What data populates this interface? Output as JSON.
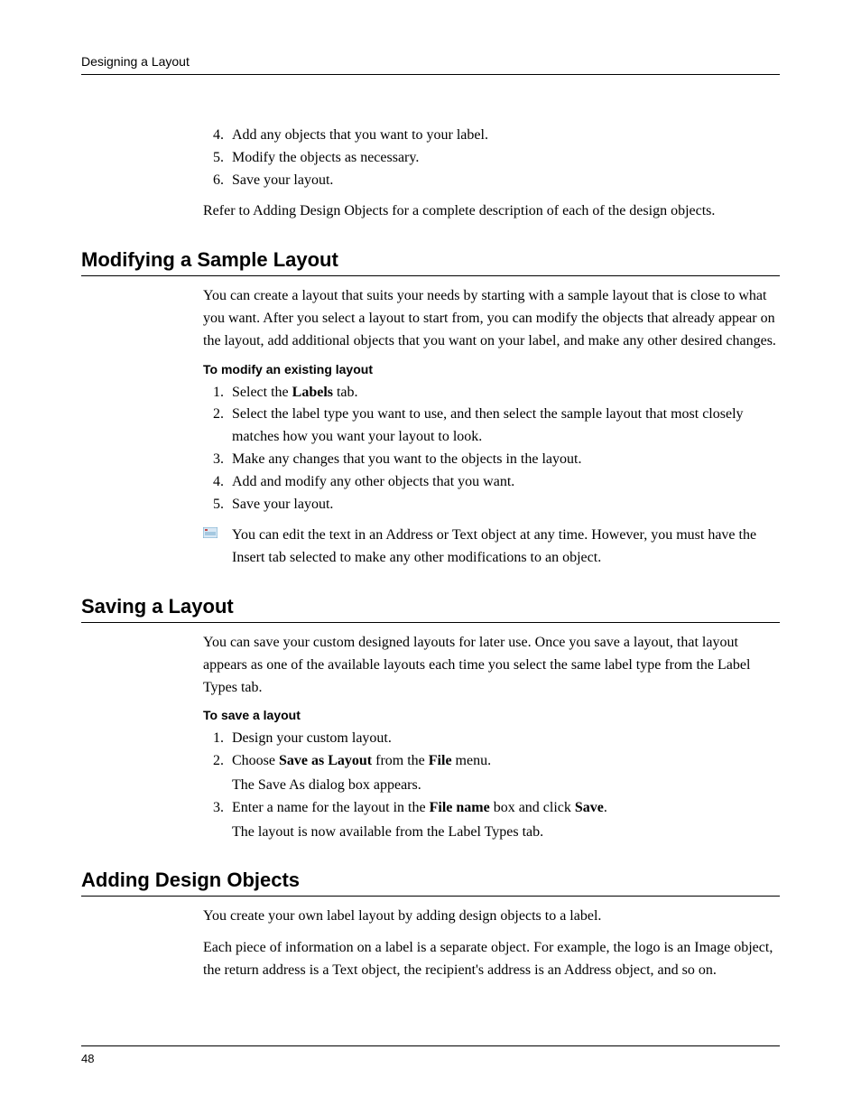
{
  "header": {
    "running": "Designing a Layout"
  },
  "top_list": {
    "items": [
      {
        "n": "4.",
        "t": "Add any objects that you want to your label."
      },
      {
        "n": "5.",
        "t": "Modify the objects as necessary."
      },
      {
        "n": "6.",
        "t": "Save your layout."
      }
    ],
    "after": "Refer to Adding Design Objects for a complete description of each of the design objects."
  },
  "sec_modify": {
    "title": "Modifying a Sample Layout",
    "intro": "You can create a layout that suits your needs by starting with a sample layout that is close to what you want. After you select a layout to start from, you can modify the objects that already appear on the layout, add additional objects that you want on your label, and make any other desired changes.",
    "sub": "To modify an existing layout",
    "steps": {
      "s1": {
        "n": "1.",
        "pre": "Select the ",
        "b": "Labels",
        "post": " tab."
      },
      "s2": {
        "n": "2.",
        "t": "Select the label type you want to use, and then select the sample layout that most closely matches how you want your layout to look."
      },
      "s3": {
        "n": "3.",
        "t": "Make any changes that you want to the objects in the layout."
      },
      "s4": {
        "n": "4.",
        "t": "Add and modify any other objects that you want."
      },
      "s5": {
        "n": "5.",
        "t": "Save your layout."
      }
    },
    "note": "You can edit the text in an Address or Text object at any time. However, you must have the Insert tab selected to make any other modifications to an object."
  },
  "sec_save": {
    "title": "Saving a Layout",
    "intro": "You can save your custom designed layouts for later use. Once you save a layout, that layout appears as one of the available layouts each time you select the same label type from the Label Types tab.",
    "sub": "To save a layout",
    "steps": {
      "s1": {
        "n": "1.",
        "t": "Design your custom layout."
      },
      "s2": {
        "n": "2.",
        "pre": "Choose ",
        "b1": "Save as Layout",
        "mid": " from the ",
        "b2": "File",
        "post": " menu.",
        "sub": "The Save As dialog box appears."
      },
      "s3": {
        "n": "3.",
        "pre": "Enter a name for the layout in the ",
        "b1": "File name",
        "mid": " box and click ",
        "b2": "Save",
        "post": ".",
        "sub": "The layout is now available from the Label Types tab."
      }
    }
  },
  "sec_add": {
    "title": "Adding Design Objects",
    "p1": "You create your own label layout by adding design objects to a label.",
    "p2": "Each piece of information on a label is a separate object. For example, the logo is an Image object, the return address is a Text object, the recipient's address is an Address object, and so on."
  },
  "footer": {
    "page": "48"
  }
}
